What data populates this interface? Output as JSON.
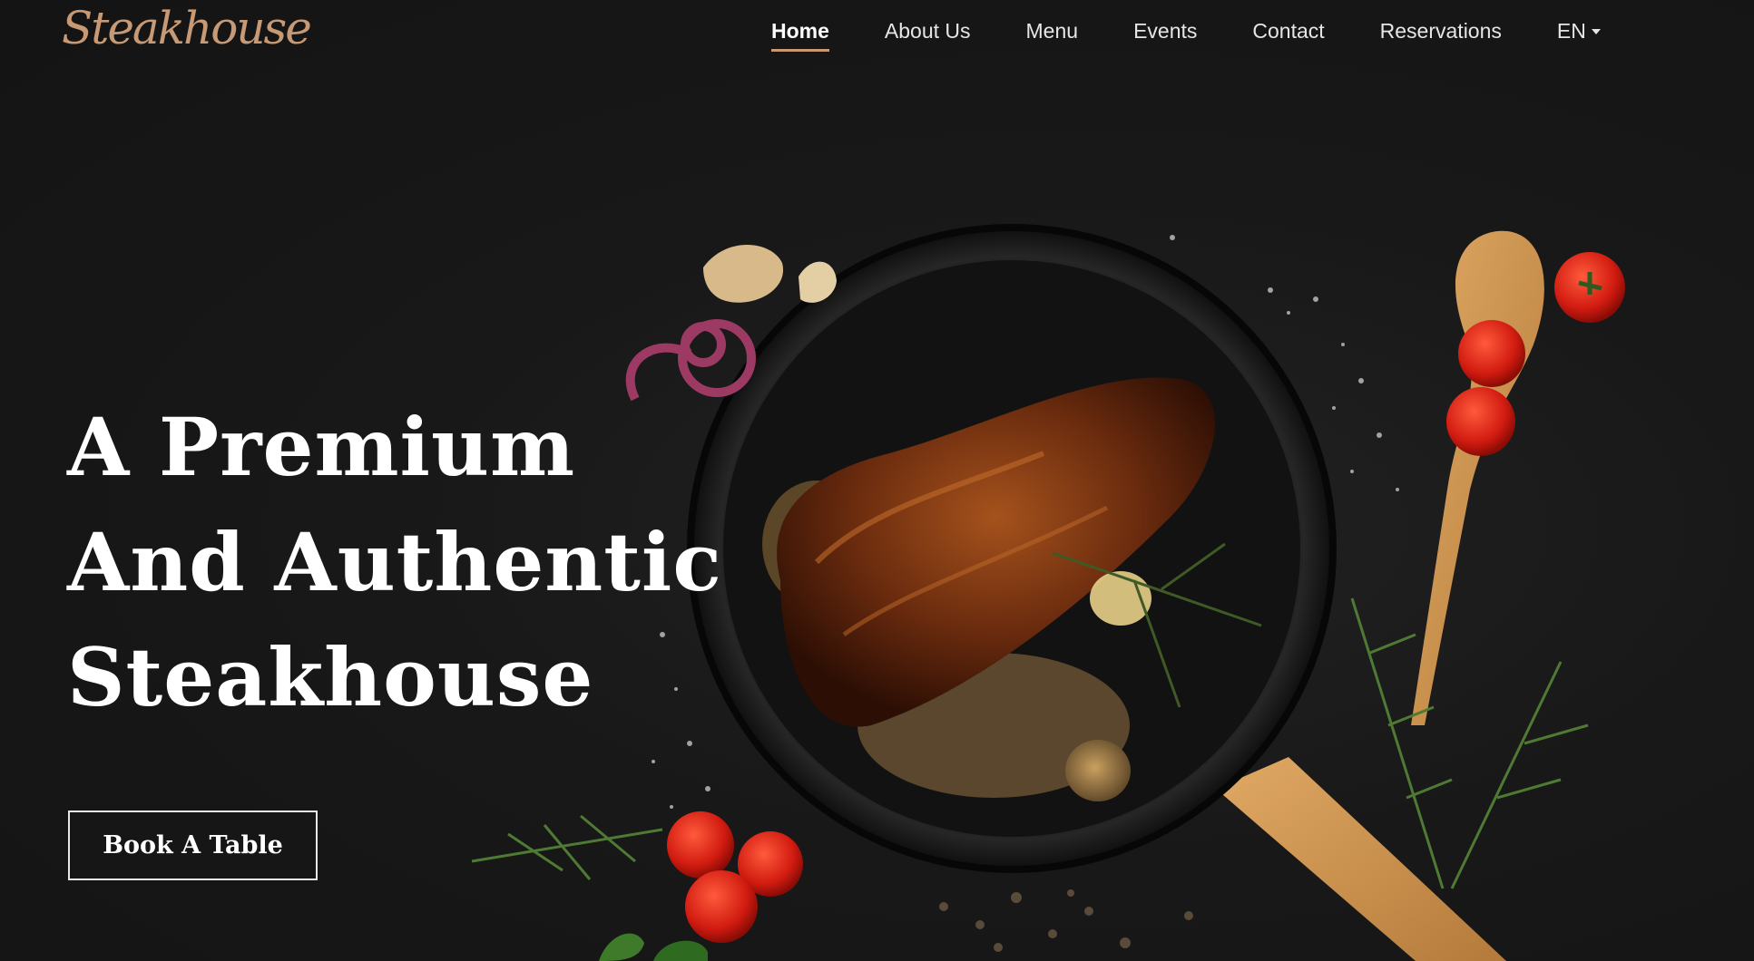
{
  "header": {
    "logo_text": "Steakhouse",
    "nav": {
      "home": "Home",
      "about": "About Us",
      "menu": "Menu",
      "events": "Events",
      "contact": "Contact",
      "reservations": "Reservations",
      "language": "EN"
    },
    "active_item": "Home"
  },
  "hero": {
    "title_lines": [
      "A Premium",
      "And Authentic",
      "Steakhouse"
    ],
    "cta_label": "Book A Table"
  },
  "colors": {
    "background": "#161616",
    "accent": "#c79a75",
    "text": "#ffffff"
  },
  "icons": {
    "language_dropdown": "caret-down-icon"
  }
}
